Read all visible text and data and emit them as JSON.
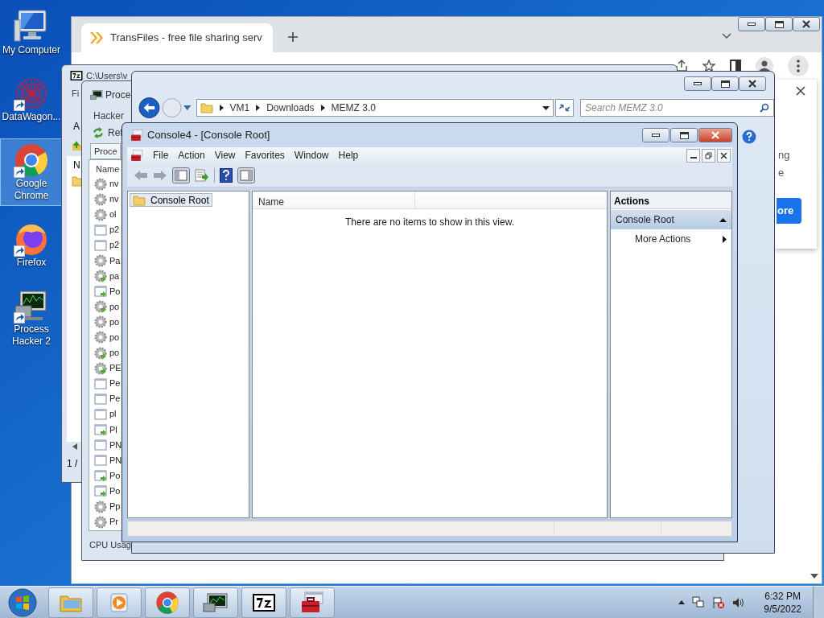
{
  "desktop_icons": [
    {
      "label": "My Computer",
      "kind": "computer",
      "shortcut": false,
      "selected": false
    },
    {
      "label": "DataWagon...",
      "kind": "network",
      "shortcut": true,
      "selected": false
    },
    {
      "label": "Google Chrome",
      "kind": "chrome",
      "shortcut": true,
      "selected": true
    },
    {
      "label": "Firefox",
      "kind": "firefox",
      "shortcut": true,
      "selected": false
    },
    {
      "label": "Process Hacker 2",
      "kind": "monitor",
      "shortcut": true,
      "selected": false
    }
  ],
  "browser": {
    "tab_title": "TransFiles - free file sharing serv",
    "popup_texts": [
      "ng",
      "e"
    ],
    "popup_button": "ore"
  },
  "archiver": {
    "title": "C:\\Users\\v",
    "menu": "Fi",
    "label": "A",
    "column": "N",
    "status": "1 /"
  },
  "process_hacker": {
    "title": "Proce",
    "menu": "Hacker",
    "refresh": "Ref",
    "tab": "Proce",
    "column": "Name",
    "status": "CPU Usag",
    "rows": [
      {
        "name": "nv",
        "kind": "gear"
      },
      {
        "name": "nv",
        "kind": "gear"
      },
      {
        "name": "ol",
        "kind": "gear"
      },
      {
        "name": "p2",
        "kind": "window"
      },
      {
        "name": "p2",
        "kind": "window"
      },
      {
        "name": "Pa",
        "kind": "gear"
      },
      {
        "name": "pa",
        "kind": "gear-arrow"
      },
      {
        "name": "Po",
        "kind": "window-arrow"
      },
      {
        "name": "po",
        "kind": "gear-arrow"
      },
      {
        "name": "po",
        "kind": "gear"
      },
      {
        "name": "po",
        "kind": "gear"
      },
      {
        "name": "po",
        "kind": "gear-arrow"
      },
      {
        "name": "PE",
        "kind": "gear-arrow"
      },
      {
        "name": "Pe",
        "kind": "window"
      },
      {
        "name": "Pe",
        "kind": "window"
      },
      {
        "name": "pl",
        "kind": "window"
      },
      {
        "name": "Pl",
        "kind": "window-arrow"
      },
      {
        "name": "PN",
        "kind": "window"
      },
      {
        "name": "PN",
        "kind": "window"
      },
      {
        "name": "Po",
        "kind": "window-arrow"
      },
      {
        "name": "Po",
        "kind": "window-arrow"
      },
      {
        "name": "Pp",
        "kind": "gear"
      },
      {
        "name": "Pr",
        "kind": "gear"
      }
    ]
  },
  "explorer": {
    "breadcrumb": [
      "VM1",
      "Downloads",
      "MEMZ 3.0"
    ],
    "search": {
      "placeholder": "Search MEMZ 3.0"
    }
  },
  "console": {
    "title": "Console4 - [Console Root]",
    "menu": [
      "File",
      "Action",
      "View",
      "Favorites",
      "Window",
      "Help"
    ],
    "tree": [
      {
        "label": "Console Root",
        "selected": true
      }
    ],
    "column": "Name",
    "empty_text": "There are no items to show in this view.",
    "actions_title": "Actions",
    "actions": [
      {
        "label": "Console Root",
        "kind": "header"
      },
      {
        "label": "More Actions",
        "kind": "item"
      }
    ]
  },
  "taskbar": {
    "apps": [
      {
        "kind": "folder"
      },
      {
        "kind": "media"
      },
      {
        "kind": "chrome"
      },
      {
        "kind": "monitor"
      },
      {
        "kind": "archive"
      },
      {
        "kind": "toolbox"
      }
    ],
    "time": "6:32 PM",
    "date": "9/5/2022"
  }
}
